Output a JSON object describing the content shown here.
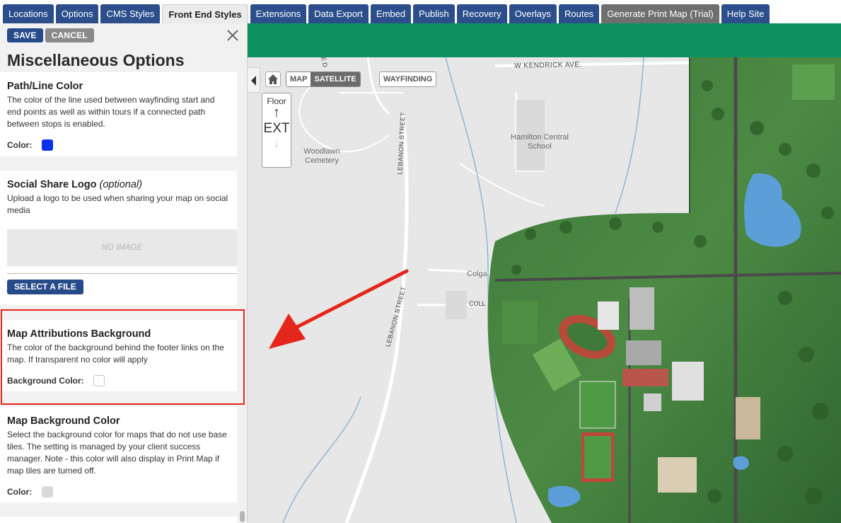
{
  "tabs": [
    {
      "label": "Locations",
      "active": false
    },
    {
      "label": "Options",
      "active": false
    },
    {
      "label": "CMS Styles",
      "active": false
    },
    {
      "label": "Front End Styles",
      "active": true
    },
    {
      "label": "Extensions",
      "active": false
    },
    {
      "label": "Data Export",
      "active": false
    },
    {
      "label": "Embed",
      "active": false
    },
    {
      "label": "Publish",
      "active": false
    },
    {
      "label": "Recovery",
      "active": false
    },
    {
      "label": "Overlays",
      "active": false
    },
    {
      "label": "Routes",
      "active": false
    },
    {
      "label": "Generate Print Map (Trial)",
      "active": false
    },
    {
      "label": "Help Site",
      "active": false
    }
  ],
  "panel": {
    "save_label": "SAVE",
    "cancel_label": "CANCEL",
    "title": "Miscellaneous Options",
    "path_color": {
      "heading": "Path/Line Color",
      "description": "The color of the line used between wayfinding start and end points as well as within tours if a connected path between stops is enabled.",
      "field_label": "Color:",
      "color": "#0b32e8"
    },
    "social_logo": {
      "heading": "Social Share Logo",
      "heading_suffix": "(optional)",
      "description": "Upload a logo to be used when sharing your map on social media",
      "no_image": "NO IMAGE",
      "select_file_label": "SELECT A FILE"
    },
    "attributions": {
      "heading": "Map Attributions Background",
      "description": "The color of the background behind the footer links on the map. If transparent no color will apply",
      "field_label": "Background Color:",
      "color": "transparent"
    },
    "map_background": {
      "heading": "Map Background Color",
      "description": "Select the background color for maps that do not use base tiles. The setting is managed by your client success manager. Note - this color will also display in Print Map if map tiles are turned off.",
      "field_label": "Color:",
      "color": "#d9d9d9"
    }
  },
  "map": {
    "toggle_map": "MAP",
    "toggle_satellite": "SATELLITE",
    "wayfinding": "WAYFINDING",
    "floor_label": "Floor",
    "floor_up": "↑",
    "floor_level": "EXT",
    "floor_down": "↓",
    "labels": {
      "kendrick": "W KENDRICK AVE.",
      "lebanon_top": "LEBANON STREET",
      "lebanon_bottom": "LEBANON STREET",
      "woodlawn": "Woodlawn Cemetery",
      "hamilton": "Hamilton Central School",
      "colga": "Colga",
      "coll": "COLL",
      "de": "E D"
    }
  },
  "colors": {
    "tab_blue": "#2c4f8c",
    "header_green": "#0f9262",
    "annotation_red": "#e4261b"
  }
}
